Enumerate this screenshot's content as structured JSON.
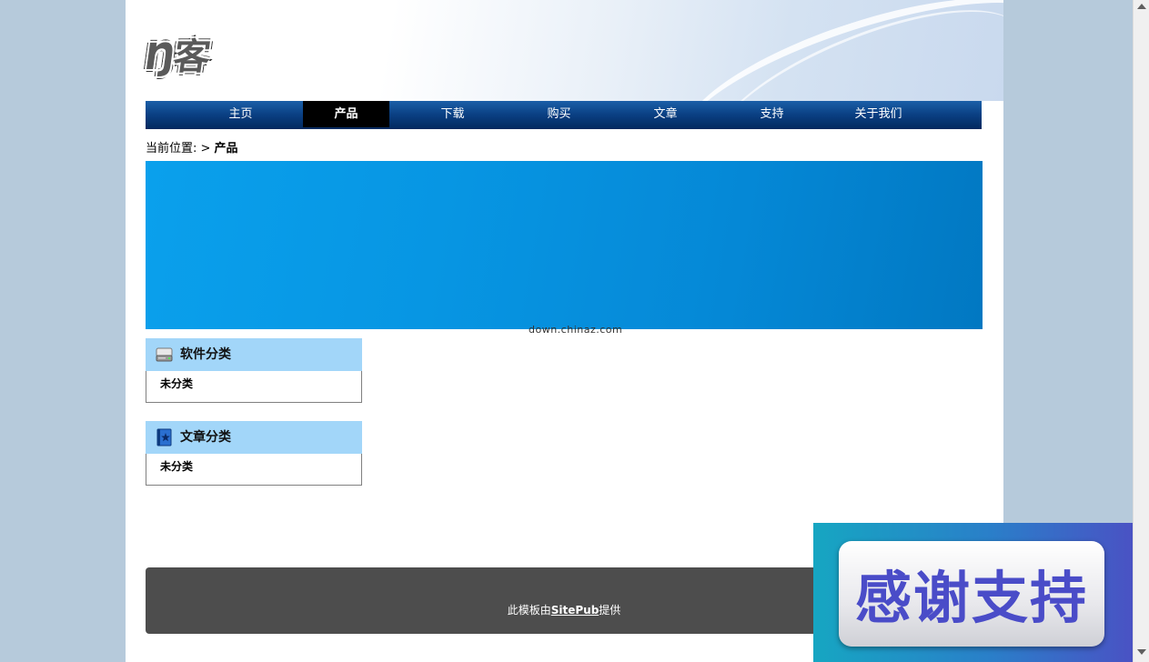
{
  "logo": {
    "text": "Ŋ客"
  },
  "nav": {
    "items": [
      {
        "label": "主页"
      },
      {
        "label": "产品"
      },
      {
        "label": "下载"
      },
      {
        "label": "购买"
      },
      {
        "label": "文章"
      },
      {
        "label": "支持"
      },
      {
        "label": "关于我们"
      }
    ],
    "active_index": 1
  },
  "breadcrumb": {
    "prefix": "当前位置: > ",
    "current": "产品"
  },
  "banner": {
    "watermark": "down.chinaz.com"
  },
  "sidebar": {
    "software": {
      "icon": "drive-icon",
      "title": "软件分类",
      "item": "未分类"
    },
    "articles": {
      "icon": "book-icon",
      "title": "文章分类",
      "item": "未分类"
    }
  },
  "footer": {
    "prefix": "此模板由",
    "link": "SitePub",
    "suffix": "提供"
  },
  "overlay": {
    "text": "感谢支持"
  },
  "colors": {
    "nav_bg": "#0a3f82",
    "nav_active": "#000000",
    "banner": "#0796e3",
    "box_head": "#a2d6f9",
    "footer_bg": "#4d4d4d",
    "page_bg": "#b6cadb"
  }
}
